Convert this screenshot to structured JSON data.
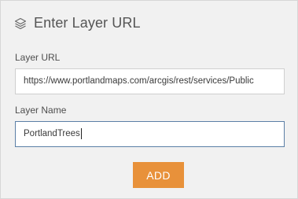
{
  "header": {
    "icon": "layers-icon",
    "title": "Enter Layer URL"
  },
  "form": {
    "url_label": "Layer URL",
    "url_value": "https://www.portlandmaps.com/arcgis/rest/services/Public",
    "name_label": "Layer Name",
    "name_value": "PortlandTrees"
  },
  "actions": {
    "add_label": "ADD"
  },
  "colors": {
    "accent": "#e8913a",
    "focus_border": "#5b7fa6"
  }
}
